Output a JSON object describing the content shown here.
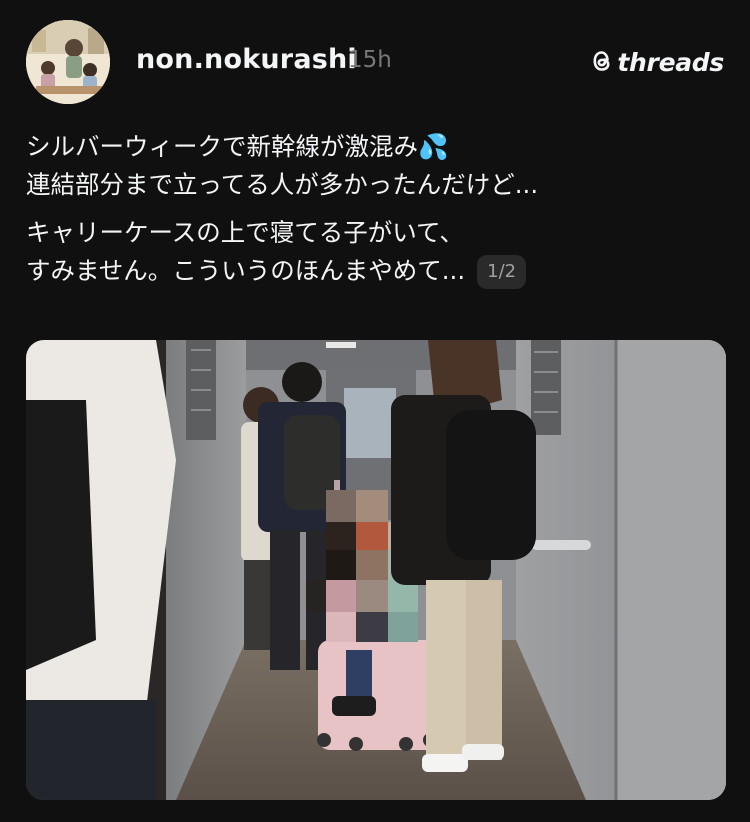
{
  "post": {
    "username": "non.nokurashi",
    "time": "15h",
    "brand": "threads",
    "text_line1": "シルバーウィークで新幹線が激混み",
    "emoji": "💦",
    "text_line2": "連結部分まで立ってる人が多かったんだけど...",
    "text_line3": "キャリーケースの上で寝てる子がいて、",
    "text_line4": "すみません。こういうのほんまやめて...",
    "page_indicator": "1/2"
  },
  "icons": {
    "avatar": "illustrated-avatar",
    "brand": "threads-logo-icon",
    "emoji": "sweat-droplets-emoji"
  }
}
